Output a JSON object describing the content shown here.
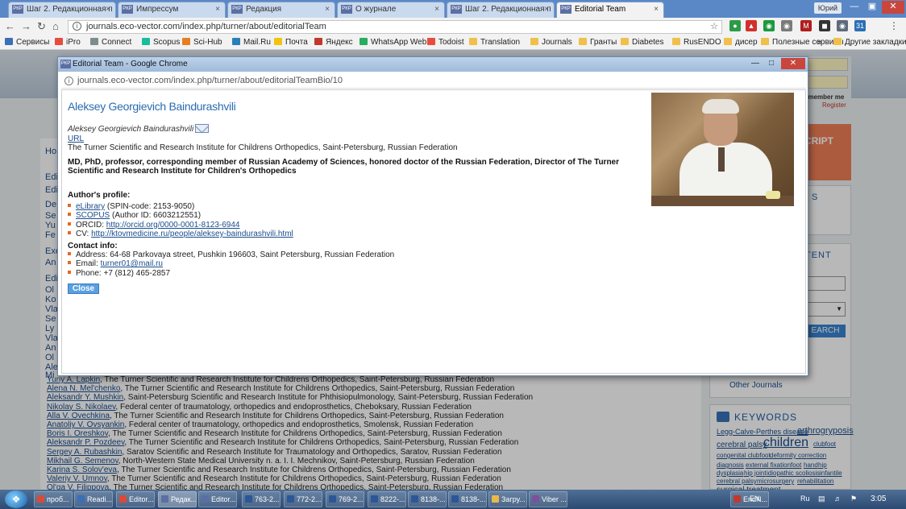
{
  "tabs": [
    {
      "label": "Шаг 2. Редакционная п",
      "active": false
    },
    {
      "label": "Импрессум",
      "active": false
    },
    {
      "label": "Редакция",
      "active": false
    },
    {
      "label": "О журнале",
      "active": false
    },
    {
      "label": "Шаг 2. Редакционная п",
      "active": false
    },
    {
      "label": "Editorial Team",
      "active": true
    }
  ],
  "tab_favicon": "РКР",
  "user_button": "Юрий",
  "browser": {
    "address": "journals.eco-vector.com/index.php/turner/about/editorialTeam"
  },
  "bookmarks": [
    "Сервисы",
    "iPro",
    "Connect",
    "Scopus",
    "Sci-Hub",
    "Mail.Ru",
    "Почта",
    "Яндекс",
    "WhatsApp Web",
    "Todoist",
    "Translation",
    "Journals",
    "Гранты",
    "Diabetes",
    "RusENDO",
    "дисер",
    "Полезные сервисы"
  ],
  "bookmarks_more": "»",
  "bookmarks_other": "Другие закладки",
  "background_page": {
    "rows": [
      {
        "name": "Yuriy A. Lapkin",
        "rest": ", The Turner Scientific and Research Institute for Childrens Orthopedics, Saint-Petersburg, Russian Federation"
      },
      {
        "name": "Alena N. Mel'chenko",
        "rest": ", The Turner Scientific and Research Institute for Childrens Orthopedics, Saint-Petersburg, Russian Federation"
      },
      {
        "name": "Aleksandr Y. Mushkin",
        "rest": ", Saint-Petersburg Scientific and Research Institute for Phthisiopulmonology, Saint-Petersburg, Russian Federation"
      },
      {
        "name": "Nikolay S. Nikolaev",
        "rest": ", Federal center of traumatology, orthopedics and endoprosthetics, Cheboksary, Russian Federation"
      },
      {
        "name": "Alla V. Ovechkina",
        "rest": ", The Turner Scientific and Research Institute for Childrens Orthopedics, Saint-Petersburg, Russian Federation"
      },
      {
        "name": "Anatoliy V. Ovsyankin",
        "rest": ", Federal center of traumatology, orthopedics and endoprosthetics, Smolensk, Russian Federation"
      },
      {
        "name": "Boris I. Oreshkov",
        "rest": ", The Turner Scientific and Research Institute for Childrens Orthopedics, Saint-Petersburg, Russian Federation"
      },
      {
        "name": "Aleksandr P. Pozdeev",
        "rest": ", The Turner Scientific and Research Institute for Childrens Orthopedics, Saint-Petersburg, Russian Federation"
      },
      {
        "name": "Sergey A. Rubashkin",
        "rest": ", Saratov Scientific and Research Institute for Traumatology and Orthopedics, Saratov, Russian Federation"
      },
      {
        "name": "Mikhail G. Semenov",
        "rest": ", North-Western State Medical University n. a. I. I. Mechnikov, Saint-Petersburg, Russian Federation"
      },
      {
        "name": "Karina S. Solov'eva",
        "rest": ", The Turner Scientific and Research Institute for Childrens Orthopedics, Saint-Petersburg, Russian Federation"
      },
      {
        "name": "Valeriy V. Umnov",
        "rest": ", The Turner Scientific and Research Institute for Childrens Orthopedics, Saint-Petersburg, Russian Federation"
      },
      {
        "name": "Ol'ga V. Filippova",
        "rest": ", The Turner Scientific and Research Institute for Childrens Orthopedics, Saint-Petersburg, Russian Federation"
      }
    ],
    "left_fragments": [
      "Ho",
      "Edi",
      "Edi",
      "De",
      "Se",
      "Yu",
      "Fe",
      "Exe",
      "An",
      "Edi",
      "Ol",
      "Ko",
      "Vla",
      "Se",
      "Ly",
      "Vla",
      "An",
      "Ol",
      "Ale",
      "Mi"
    ],
    "right_fragments": {
      "login_line": "emember me",
      "register": "Register",
      "submit_banner": "CRIPT",
      "content_heading": "TENT",
      "search_button": "EARCH",
      "other_journals": "Other Journals"
    },
    "keywords_title": "KEYWORDS",
    "keywords": [
      {
        "text": "Legg-Calve-Perthes disease",
        "size": 9
      },
      {
        "text": "arthrogryposis",
        "size": 11
      },
      {
        "text": "cerebral palsy",
        "size": 10
      },
      {
        "text": "children",
        "size": 16
      },
      {
        "text": "clubfoot",
        "size": 8
      },
      {
        "text": "congenital clubfoot",
        "size": 8
      },
      {
        "text": "deformity correction",
        "size": 8
      },
      {
        "text": "diagnosis",
        "size": 8
      },
      {
        "text": "external fixation",
        "size": 8
      },
      {
        "text": "foot",
        "size": 8
      },
      {
        "text": "hand",
        "size": 8
      },
      {
        "text": "hip",
        "size": 8
      },
      {
        "text": "dysplasia",
        "size": 8
      },
      {
        "text": "hip joint",
        "size": 8
      },
      {
        "text": "idiopathic scoliosis",
        "size": 8
      },
      {
        "text": "infantile",
        "size": 8
      },
      {
        "text": "cerebral palsy",
        "size": 8
      },
      {
        "text": "microsurgery",
        "size": 8
      },
      {
        "text": "rehabilitation",
        "size": 8
      },
      {
        "text": "surgical treatment",
        "size": 10
      }
    ]
  },
  "popup": {
    "window_title": "Editorial Team - Google Chrome",
    "address": "journals.eco-vector.com/index.php/turner/about/editorialTeamBio/10",
    "name": "Aleksey Georgievich Baindurashvili",
    "name_italic": "Aleksey Georgievich Baindurashvili",
    "url_label": "URL",
    "affiliation": "The Turner Scientific and Research Institute for Childrens Orthopedics, Saint-Petersburg, Russian Federation",
    "bio": "MD, PhD, professor, corresponding member of Russian Academy of Sciences, honored doctor of the Russian Federation, Director of The Turner Scientific and Research Institute for Children's Orthopedics",
    "profile_heading": "Author's profile:",
    "profile_items": [
      {
        "link": "eLibrary",
        "text": " (SPIN-code: 2153-9050)"
      },
      {
        "link": "SCOPUS",
        "text": " (Author ID: 6603212551)"
      },
      {
        "prefix": "ORCID: ",
        "link": "http://orcid.org/0000-0001-8123-6944",
        "text": ""
      },
      {
        "prefix": "CV: ",
        "link": "http://ktovmedicine.ru/people/aleksey-baindurashvili.html",
        "text": ""
      }
    ],
    "contact_heading": "Contact info:",
    "contact_items": [
      {
        "prefix": "Address: 64-68 Parkovaya street, Pushkin 196603, Saint Petersburg, Russian Federation",
        "link": ""
      },
      {
        "prefix": "Email: ",
        "link": "turner01@mail.ru"
      },
      {
        "prefix": "Phone: +7 (812) 465-2857",
        "link": ""
      }
    ],
    "close_button": "Close"
  },
  "taskbar": {
    "items": [
      {
        "label": "проб...",
        "color": "#d94a38"
      },
      {
        "label": "Readi...",
        "color": "#3b6fb6"
      },
      {
        "label": "Editor...",
        "color": "#d94a38"
      },
      {
        "label": "Редак...",
        "color": "#5b6fa3"
      },
      {
        "label": "Editor...",
        "color": "#5b6fa3"
      },
      {
        "label": "763-2...",
        "color": "#2b5797"
      },
      {
        "label": "772-2...",
        "color": "#2b5797"
      },
      {
        "label": "769-2...",
        "color": "#2b5797"
      },
      {
        "label": "8222-...",
        "color": "#2b5797"
      },
      {
        "label": "8138-...",
        "color": "#2b5797"
      },
      {
        "label": "8138-...",
        "color": "#2b5797"
      },
      {
        "label": "Загру...",
        "color": "#e8b84a"
      },
      {
        "label": "Viber ...",
        "color": "#7b519d"
      },
      {
        "label": "EndN...",
        "color": "#c0392b"
      }
    ],
    "language": "Ru",
    "language2": "EN",
    "clock": "3:05"
  }
}
